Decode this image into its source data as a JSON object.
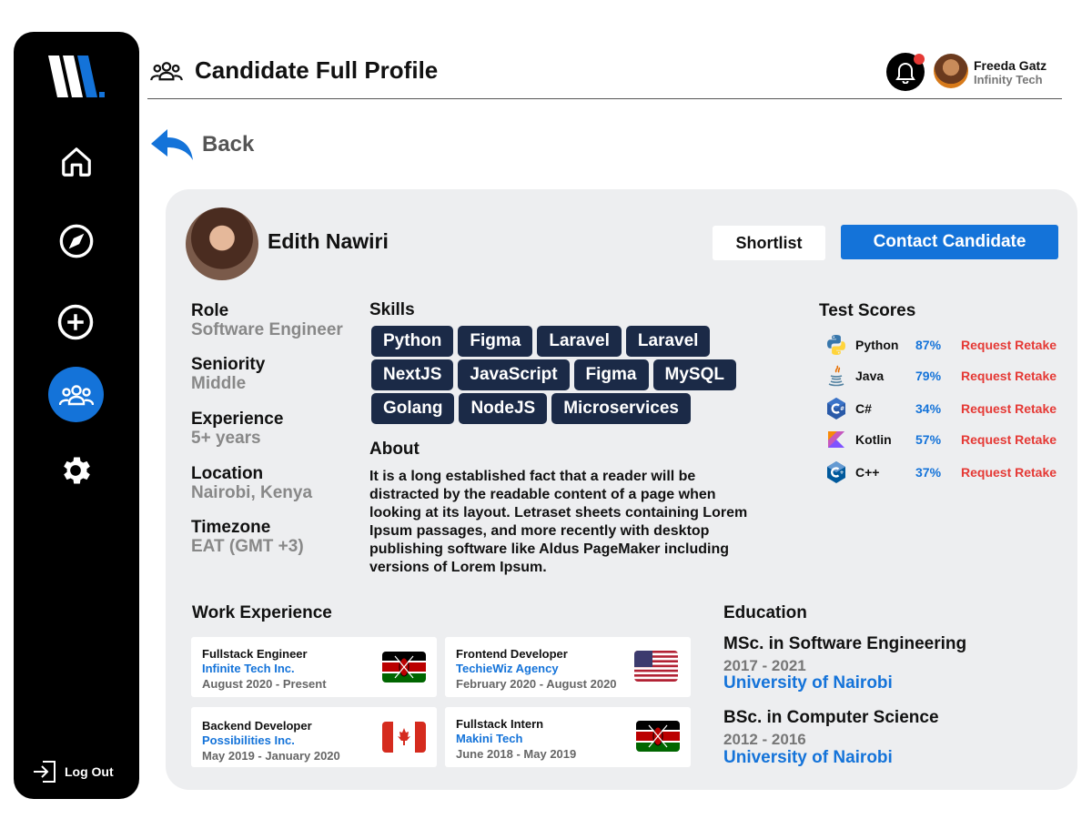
{
  "header": {
    "title": "Candidate Full Profile"
  },
  "user": {
    "name": "Freeda Gatz",
    "company": "Infinity Tech"
  },
  "back": {
    "label": "Back"
  },
  "sidebar": {
    "logout_label": "Log Out"
  },
  "candidate": {
    "name": "Edith Nawiri",
    "shortlist_label": "Shortlist",
    "contact_label": "Contact Candidate"
  },
  "details": [
    {
      "label": "Role",
      "value": "Software Engineer"
    },
    {
      "label": "Seniority",
      "value": "Middle"
    },
    {
      "label": "Experience",
      "value": "5+ years"
    },
    {
      "label": "Location",
      "value": "Nairobi, Kenya"
    },
    {
      "label": "Timezone",
      "value": "EAT (GMT +3)"
    }
  ],
  "skills": {
    "title": "Skills",
    "items": [
      "Python",
      "Figma",
      "Laravel",
      "Laravel",
      "NextJS",
      "JavaScript",
      "Figma",
      "MySQL",
      "Golang",
      "NodeJS",
      "Microservices"
    ]
  },
  "about": {
    "title": "About",
    "text": "It is a long established fact that a reader will be distracted by the readable content of a page when looking at its layout.  Letraset sheets containing Lorem Ipsum passages, and more recently with desktop publishing software like Aldus PageMaker including versions of Lorem Ipsum."
  },
  "test_scores": {
    "title": "Test Scores",
    "items": [
      {
        "lang": "Python",
        "score": "87%",
        "action": "Request Retake",
        "icon": "python-icon"
      },
      {
        "lang": "Java",
        "score": "79%",
        "action": "Request Retake",
        "icon": "java-icon"
      },
      {
        "lang": "C#",
        "score": "34%",
        "action": "Request Retake",
        "icon": "csharp-icon"
      },
      {
        "lang": "Kotlin",
        "score": "57%",
        "action": "Request Retake",
        "icon": "kotlin-icon"
      },
      {
        "lang": "C++",
        "score": "37%",
        "action": "Request Retake",
        "icon": "cpp-icon"
      }
    ]
  },
  "work": {
    "title": "Work Experience",
    "items": [
      {
        "title": "Fullstack Engineer",
        "company": "Infinite Tech Inc.",
        "dates": "August 2020 - Present",
        "flag": "kenya-flag-icon"
      },
      {
        "title": "Frontend Developer",
        "company": "TechieWiz Agency",
        "dates": "February 2020 - August 2020",
        "flag": "usa-flag-icon"
      },
      {
        "title": "Backend Developer",
        "company": "Possibilities Inc.",
        "dates": "May 2019 - January 2020",
        "flag": "canada-flag-icon"
      },
      {
        "title": "Fullstack Intern",
        "company": "Makini Tech",
        "dates": "June 2018 - May 2019",
        "flag": "kenya-flag-icon"
      }
    ]
  },
  "education": {
    "title": "Education",
    "items": [
      {
        "degree": "MSc. in Software Engineering",
        "years": "2017 - 2021",
        "school": "University of Nairobi"
      },
      {
        "degree": "BSc. in Computer Science",
        "years": "2012 - 2016",
        "school": "University of Nairobi"
      }
    ]
  },
  "colors": {
    "accent": "#1473d9",
    "chip": "#1b2a47",
    "danger": "#e53935",
    "card": "#edeef0"
  }
}
